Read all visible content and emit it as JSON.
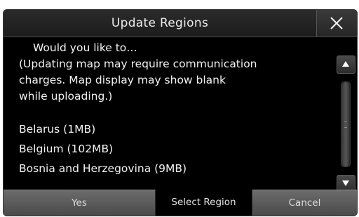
{
  "dialog": {
    "title": "Update Regions",
    "prompt": "Would you like to…",
    "note": "(Updating map may require communication\ncharges. Map display may show blank\nwhile uploading.)",
    "regions": [
      {
        "label": "Belarus (1MB)"
      },
      {
        "label": "Belgium (102MB)"
      },
      {
        "label": "Bosnia and Herzegovina (9MB)"
      }
    ]
  },
  "buttons": {
    "yes_label": "Yes",
    "select_region_label": "Select Region",
    "cancel_label": "Cancel"
  },
  "icons": {
    "close": "close-icon",
    "scroll_up": "triangle-up-icon",
    "scroll_down": "triangle-down-icon"
  },
  "colors": {
    "background": "#000000",
    "text": "#f2f2f2",
    "button": "#5a5a5a"
  }
}
